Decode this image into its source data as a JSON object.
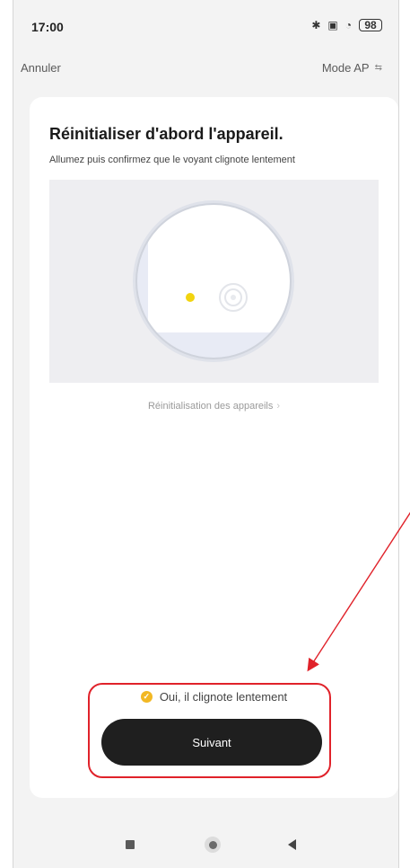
{
  "status_bar": {
    "time": "17:00",
    "icons": [
      "bluetooth-icon",
      "nfc-icon",
      "wifi-icon",
      "battery-icon"
    ],
    "battery_level": "98"
  },
  "top_nav": {
    "cancel_label": "Annuler",
    "mode_label": "Mode AP",
    "mode_icon": "swap-icon"
  },
  "card": {
    "title": "Réinitialiser d'abord l'appareil.",
    "subtitle": "Allumez puis confirmez que le voyant clignote lentement",
    "illustration": "device-led-blinking-illustration",
    "reset_link_label": "Réinitialisation des appareils"
  },
  "confirm": {
    "checkbox_label": "Oui, il clignote lentement",
    "checked": true,
    "accent_color": "#f2b824"
  },
  "next_button_label": "Suivant",
  "annotation_color": "#e0222a",
  "nav_bar": [
    "recent-apps-icon",
    "home-icon",
    "back-icon"
  ]
}
